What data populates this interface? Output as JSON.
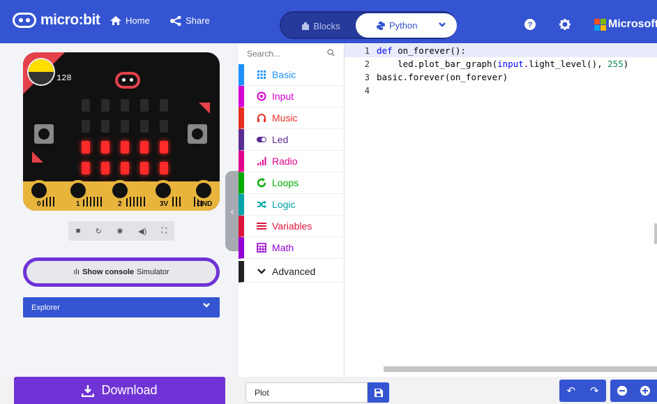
{
  "header": {
    "logo_text": "micro:bit",
    "home_label": "Home",
    "share_label": "Share",
    "tab_blocks": "Blocks",
    "tab_python": "Python",
    "brand": "Microsoft",
    "accent_color": "#3454d1"
  },
  "simulator": {
    "light_level": "128",
    "pin_labels": [
      "0",
      "1",
      "2",
      "3V",
      "GND"
    ],
    "led_matrix": [
      [
        0,
        0,
        0,
        0,
        0
      ],
      [
        0,
        0,
        0,
        0,
        0
      ],
      [
        1,
        1,
        1,
        1,
        1
      ],
      [
        1,
        1,
        1,
        1,
        1
      ],
      [
        1,
        1,
        1,
        1,
        1
      ]
    ],
    "show_console_bold": "Show console",
    "show_console_suffix": "Simulator",
    "explorer_label": "Explorer"
  },
  "toolbox": {
    "search_placeholder": "Search...",
    "categories": [
      {
        "label": "Basic",
        "color": "#1e90ff",
        "icon": "grid-icon"
      },
      {
        "label": "Input",
        "color": "#d400d4",
        "icon": "target-icon"
      },
      {
        "label": "Music",
        "color": "#e63022",
        "icon": "headphones-icon"
      },
      {
        "label": "Led",
        "color": "#5c2d91",
        "icon": "toggle-icon"
      },
      {
        "label": "Radio",
        "color": "#e3008c",
        "icon": "signal-icon"
      },
      {
        "label": "Loops",
        "color": "#00aa00",
        "icon": "refresh-icon"
      },
      {
        "label": "Logic",
        "color": "#00a4a6",
        "icon": "shuffle-icon"
      },
      {
        "label": "Variables",
        "color": "#dc143c",
        "icon": "lines-icon"
      },
      {
        "label": "Math",
        "color": "#9400d3",
        "icon": "calculator-icon"
      }
    ],
    "advanced_label": "Advanced"
  },
  "editor": {
    "lines": [
      {
        "num": "1",
        "text": "def on_forever():"
      },
      {
        "num": "2",
        "text": "    led.plot_bar_graph(input.light_level(), 255)"
      },
      {
        "num": "3",
        "text": "basic.forever(on_forever)"
      },
      {
        "num": "4",
        "text": ""
      }
    ]
  },
  "bottom": {
    "download_label": "Download",
    "project_name": "Plot"
  }
}
